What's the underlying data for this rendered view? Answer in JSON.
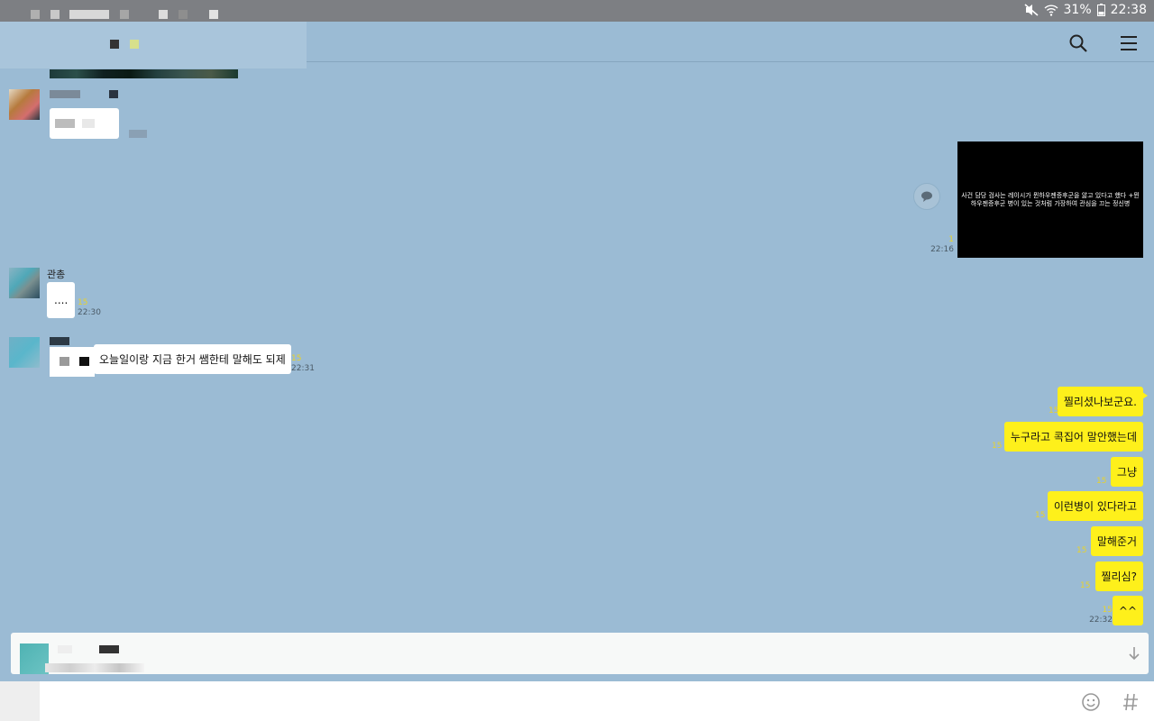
{
  "status_bar": {
    "battery": "31%",
    "time": "22:38"
  },
  "header": {
    "search_icon": "search-icon",
    "menu_icon": "menu-icon"
  },
  "messages": {
    "sent_media": {
      "caption": "사건 담당 검사는 레이시가 뮌하우젠증후군을 앓고 있다고 했다 +뮌하우젠증후군 병이 있는 것처럼 가장하여 관심을 끄는 정신병",
      "unread": "1",
      "time": "22:16"
    },
    "msg_2": {
      "sender": "관총",
      "text": "....",
      "unread": "15",
      "time": "22:30"
    },
    "msg_3": {
      "text": "오늘일이랑 지금 한거 쌤한테 말해도 되제",
      "unread": "15",
      "time": "22:31"
    },
    "sent": [
      {
        "text": "찔리셨나보군요.",
        "unread": "15"
      },
      {
        "text": "누구라고 콕집어 말안했는데",
        "unread": "15"
      },
      {
        "text": "그냥",
        "unread": "15"
      },
      {
        "text": "이런병이 있다라고",
        "unread": "15"
      },
      {
        "text": "말해준거",
        "unread": "15"
      },
      {
        "text": "찔리심?",
        "unread": "15"
      },
      {
        "text": "^^",
        "unread": "15",
        "time": "22:32"
      }
    ]
  },
  "input": {
    "emoji_icon": "emoji-icon",
    "hash_icon": "hash-icon",
    "scroll_down_icon": "arrow-down-icon"
  },
  "colors": {
    "bg": "#9bbbd4",
    "yellow_bubble": "#fef01b",
    "unread": "#e8d22c"
  }
}
